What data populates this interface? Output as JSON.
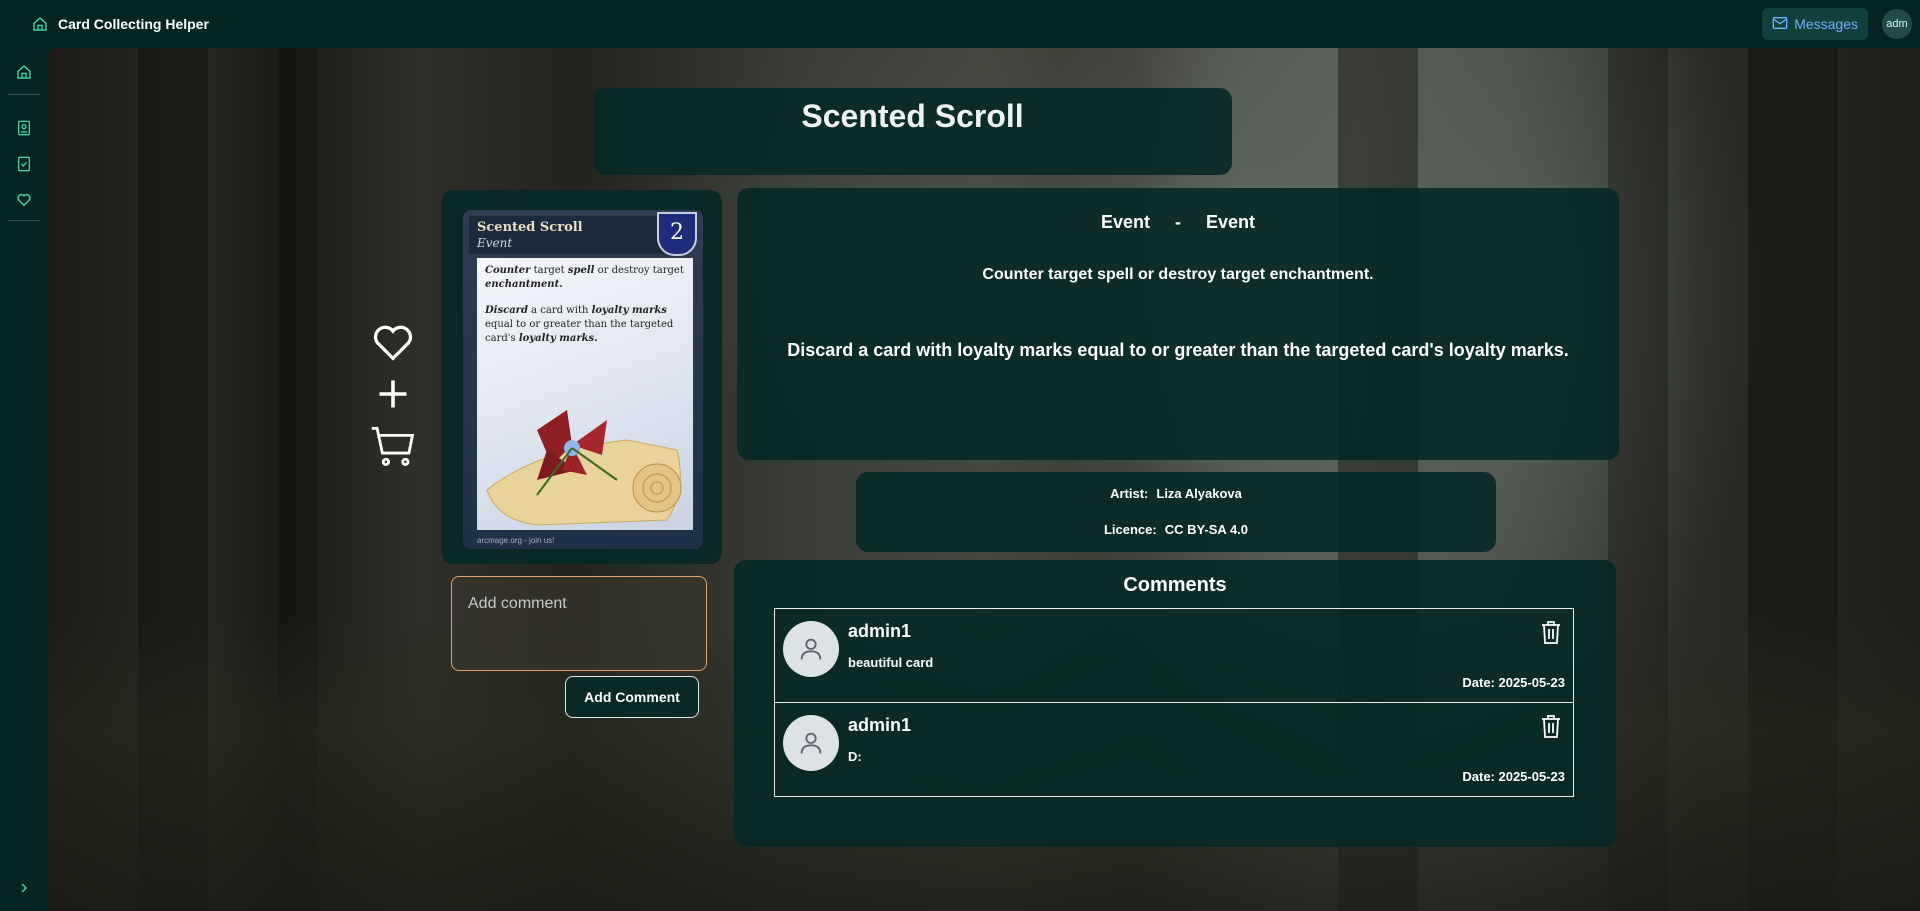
{
  "app": {
    "title": "Card Collecting Helper"
  },
  "topbar": {
    "messages_label": "Messages",
    "avatar_text": "adm"
  },
  "card": {
    "name": "Scented Scroll",
    "type_left": "Event",
    "separator": "-",
    "type_right": "Event",
    "rules": [
      "Counter target spell or destroy target enchantment.",
      "Discard a card with loyalty marks equal to or greater than the targeted card's loyalty marks."
    ],
    "image": {
      "name": "Scented Scroll",
      "type": "Event",
      "cost": "2",
      "rule_text_1_a": "Counter",
      "rule_text_1_b": " target ",
      "rule_text_1_c": "spell",
      "rule_text_1_d": " or destroy target ",
      "rule_text_1_e": "enchantment.",
      "rule_text_2_a": "Discard",
      "rule_text_2_b": " a card with ",
      "rule_text_2_c": "loyalty marks",
      "rule_text_2_d": " equal to or greater than the targeted card's ",
      "rule_text_2_e": "loyalty marks.",
      "footer": "arcmage.org - join us!"
    }
  },
  "credits": {
    "artist_label": "Artist:",
    "artist": "Liza Alyakova",
    "licence_label": "Licence:",
    "licence": "CC BY-SA 4.0"
  },
  "comment_form": {
    "placeholder": "Add comment",
    "button": "Add Comment"
  },
  "comments": {
    "title": "Comments",
    "items": [
      {
        "user": "admin1",
        "text": "beautiful card",
        "date": "Date: 2025-05-23"
      },
      {
        "user": "admin1",
        "text": "D:",
        "date": "Date: 2025-05-23"
      }
    ]
  },
  "colors": {
    "accent": "#3fd0a8",
    "panel": "#072826",
    "link": "#6fb0ff",
    "input_border": "#e0a070"
  }
}
